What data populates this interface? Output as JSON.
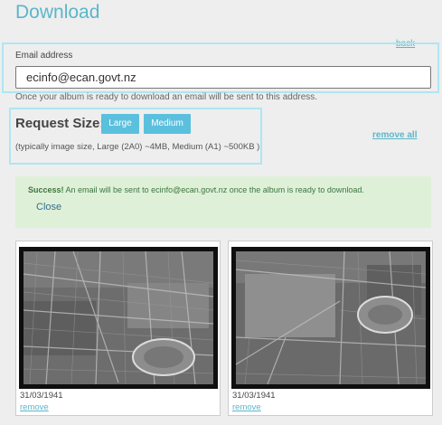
{
  "header": {
    "title": "Download",
    "back_label": "back"
  },
  "email": {
    "label": "Email address",
    "value": "ecinfo@ecan.govt.nz",
    "hint": "Once your album is ready to download an email will be sent to this address."
  },
  "request_size": {
    "label": "Request Size:",
    "options": [
      "Large",
      "Medium"
    ],
    "hint": "(typically image size, Large (2A0) ~4MB, Medium (A1) ~500KB )"
  },
  "remove_all_label": "remove all",
  "alert": {
    "strong": "Success!",
    "message": " An email will be sent to ecinfo@ecan.govt.nz once the album is ready to download.",
    "close_label": "Close",
    "background": "#dff0d8"
  },
  "album": {
    "items": [
      {
        "date": "31/03/1941",
        "remove_label": "remove"
      },
      {
        "date": "31/03/1941",
        "remove_label": "remove"
      }
    ]
  },
  "colors": {
    "accent": "#5bc0de",
    "link": "#5bb6c9",
    "highlight_border": "#aee6f2"
  }
}
